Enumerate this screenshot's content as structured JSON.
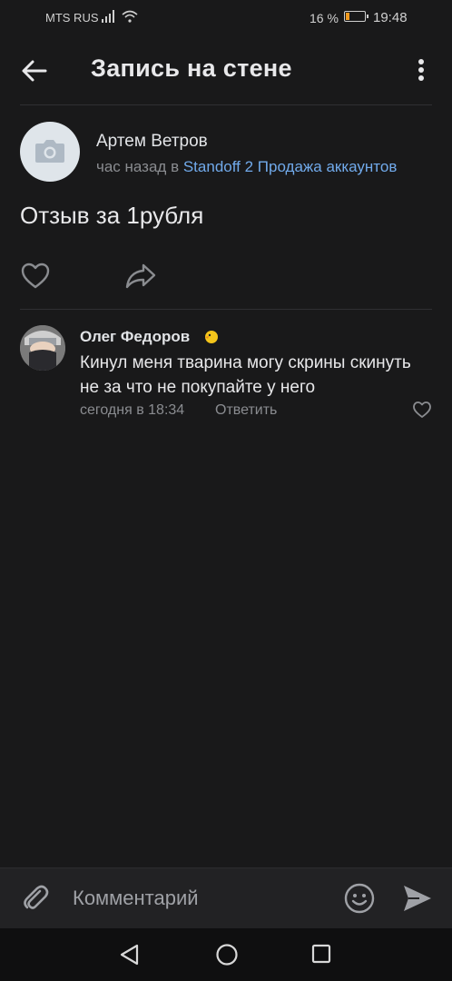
{
  "status_bar": {
    "carrier": "MTS RUS",
    "battery_percent": "16 %",
    "battery_level": 0.16,
    "time": "19:48"
  },
  "header": {
    "title": "Запись на стене"
  },
  "post": {
    "author": "Артем Ветров",
    "time": "час назад в",
    "group": "Standoff 2 Продажа аккаунтов",
    "text": "Отзыв за 1рубля"
  },
  "comment": {
    "author": "Олег Федоров",
    "text": "Кинул меня тварина могу скрины скинуть не за что не покупайте у него",
    "date": "сегодня в 18:34",
    "reply_label": "Ответить"
  },
  "input_bar": {
    "placeholder": "Комментарий"
  },
  "colors": {
    "background": "#19191a",
    "link": "#71aaeb",
    "secondary_text": "#8a8c90",
    "battery_low": "#f09a20"
  },
  "icons": [
    "back-arrow-icon",
    "more-vertical-icon",
    "camera-icon",
    "heart-icon",
    "share-icon",
    "attach-icon",
    "emoji-icon",
    "send-icon"
  ]
}
